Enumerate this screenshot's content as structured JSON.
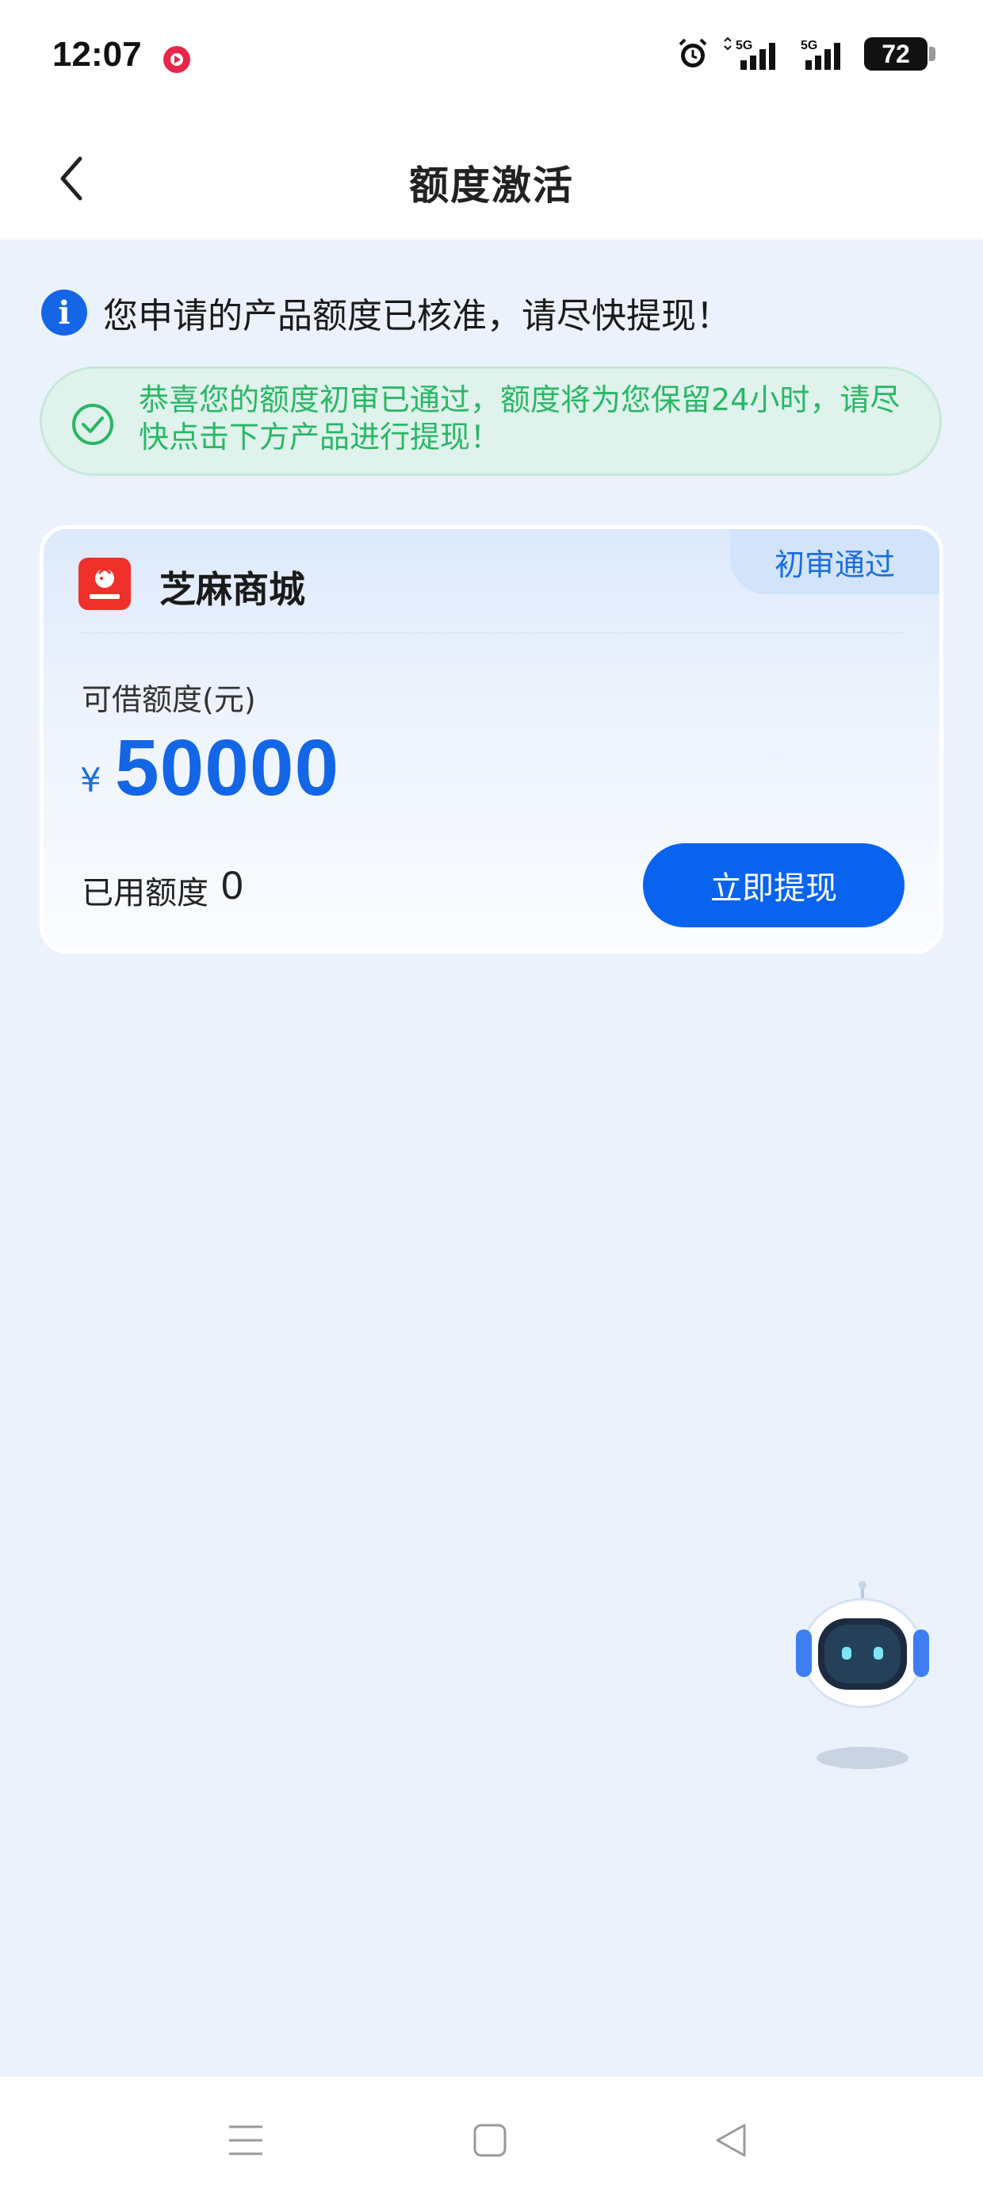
{
  "status_bar": {
    "time": "12:07",
    "battery": "72",
    "network_1": "5G",
    "network_2": "5G"
  },
  "nav": {
    "title": "额度激活"
  },
  "notice": {
    "text": "您申请的产品额度已核准，请尽快提现！"
  },
  "success": {
    "text": "恭喜您的额度初审已通过，额度将为您保留24小时，请尽快点击下方产品进行提现！"
  },
  "card": {
    "brand_name": "芝麻商城",
    "badge": "初审通过",
    "limit_label": "可借额度(元)",
    "currency": "¥",
    "amount": "50000",
    "used_label": "已用额度",
    "used_value": "0",
    "button_label": "立即提现"
  },
  "colors": {
    "primary": "#0a63ee",
    "success": "#2ab766",
    "background": "#ebf2fc"
  },
  "icons": [
    "back-arrow-icon",
    "info-icon",
    "check-circle-icon",
    "alarm-icon",
    "signal-icon",
    "robot-assistant-icon",
    "menu-icon",
    "home-square-icon",
    "back-triangle-icon"
  ]
}
